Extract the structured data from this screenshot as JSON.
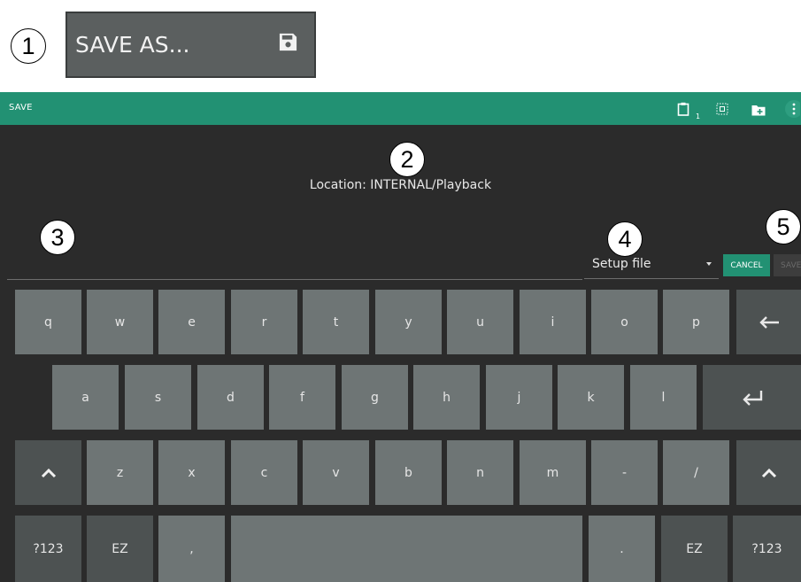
{
  "callouts": [
    "1",
    "2",
    "3",
    "4",
    "5"
  ],
  "save_as_button": {
    "label": "SAVE AS...",
    "icon": "floppy-disk-icon"
  },
  "titlebar": {
    "title": "SAVE",
    "clipboard_badge": "1",
    "icons": [
      "clipboard-icon",
      "select-all-icon",
      "new-folder-icon",
      "more-vert-icon"
    ]
  },
  "dialog": {
    "location": "Location: INTERNAL/Playback",
    "file_type": "Setup file",
    "cancel_label": "CANCEL",
    "save_label": "SAVE"
  },
  "keyboard": {
    "row1": [
      "q",
      "w",
      "e",
      "r",
      "t",
      "y",
      "u",
      "i",
      "o",
      "p"
    ],
    "backspace": "←",
    "row2": [
      "a",
      "s",
      "d",
      "f",
      "g",
      "h",
      "j",
      "k",
      "l"
    ],
    "enter": "↵",
    "shift": "^",
    "row3": [
      "z",
      "x",
      "c",
      "v",
      "b",
      "n",
      "m",
      "-",
      "/"
    ],
    "sym_left": "?123",
    "ez_left": "EZ",
    "comma": ",",
    "period": ".",
    "ez_right": "EZ",
    "sym_right": "?123"
  },
  "colors": {
    "accent": "#229173",
    "dialog_bg": "#2b2b2b",
    "key": "#6e7575",
    "key_dark": "#4d5252"
  }
}
